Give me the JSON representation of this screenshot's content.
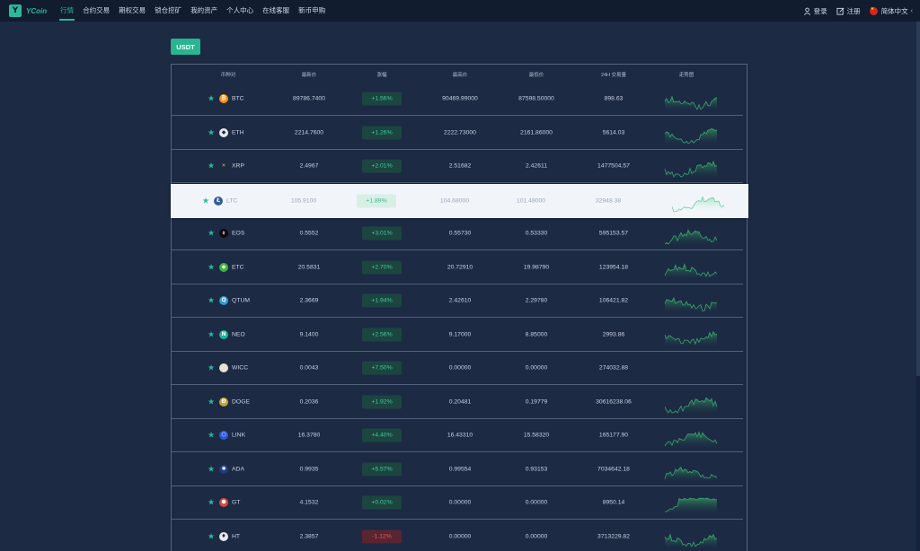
{
  "nav": {
    "logo_glyph": "Y",
    "logo_text": "YCoin",
    "items": [
      {
        "label": "行情",
        "active": true
      },
      {
        "label": "合约交易"
      },
      {
        "label": "期权交易"
      },
      {
        "label": "锁仓挖矿"
      },
      {
        "label": "我的资产"
      },
      {
        "label": "个人中心"
      },
      {
        "label": "在线客服"
      },
      {
        "label": "新币申购"
      }
    ],
    "login": "登录",
    "register": "注册",
    "language": "简体中文",
    "language_caret": "‹"
  },
  "currency_tab": "USDT",
  "table": {
    "headers": [
      "币种对",
      "最新价",
      "涨幅",
      "最高价",
      "最低价",
      "24H 交易量",
      "走势图"
    ],
    "rows": [
      {
        "symbol": "BTC",
        "price": "89786.7400",
        "change": "+1.56%",
        "high": "90469.99000",
        "low": "87598.50000",
        "volume": "898.63",
        "icon": "bitcoin-icon",
        "icon_color": "#f7931a",
        "glyph": "₿",
        "trend": "up"
      },
      {
        "symbol": "ETH",
        "price": "2214.7600",
        "change": "+1.26%",
        "high": "2222.73000",
        "low": "2161.86000",
        "volume": "5614.03",
        "icon": "ethereum-icon",
        "icon_color": "#e6e9ef",
        "glyph": "◆",
        "trend": "up"
      },
      {
        "symbol": "XRP",
        "price": "2.4967",
        "change": "+2.01%",
        "high": "2.51682",
        "low": "2.42611",
        "volume": "1477504.57",
        "icon": "xrp-icon",
        "icon_color": "#1c2a44",
        "glyph": "✕",
        "trend": "up"
      },
      {
        "symbol": "LTC",
        "price": "105.9100",
        "change": "+1.89%",
        "high": "104.68000",
        "low": "101.48000",
        "volume": "32948.38",
        "icon": "litecoin-icon",
        "icon_color": "#345d9d",
        "glyph": "Ł",
        "trend": "up",
        "highlight": true
      },
      {
        "symbol": "EOS",
        "price": "0.5552",
        "change": "+3.01%",
        "high": "0.55730",
        "low": "0.53330",
        "volume": "595153.57",
        "icon": "eos-icon",
        "icon_color": "#0b0b0b",
        "glyph": "⬨",
        "trend": "up"
      },
      {
        "symbol": "ETC",
        "price": "20.5831",
        "change": "+2.70%",
        "high": "20.72910",
        "low": "19.98790",
        "volume": "123954.18",
        "icon": "ethereum-classic-icon",
        "icon_color": "#3ab83a",
        "glyph": "◆",
        "trend": "up"
      },
      {
        "symbol": "QTUM",
        "price": "2.3669",
        "change": "+1.94%",
        "high": "2.42610",
        "low": "2.29780",
        "volume": "106421.82",
        "icon": "qtum-icon",
        "icon_color": "#2e9ad0",
        "glyph": "Q",
        "trend": "up"
      },
      {
        "symbol": "NEO",
        "price": "9.1400",
        "change": "+2.56%",
        "high": "9.17000",
        "low": "8.85000",
        "volume": "2993.86",
        "icon": "neo-icon",
        "icon_color": "#1fb39a",
        "glyph": "N",
        "trend": "up"
      },
      {
        "symbol": "WICC",
        "price": "0.0043",
        "change": "+7.50%",
        "high": "0.00000",
        "low": "0.00000",
        "volume": "274032.88",
        "icon": "wicc-icon",
        "icon_color": "#e8e2d0",
        "glyph": "",
        "trend": "none"
      },
      {
        "symbol": "DOGE",
        "price": "0.2036",
        "change": "+1.92%",
        "high": "0.20481",
        "low": "0.19779",
        "volume": "30616238.06",
        "icon": "dogecoin-icon",
        "icon_color": "#c2a633",
        "glyph": "Ð",
        "trend": "up"
      },
      {
        "symbol": "LINK",
        "price": "16.3780",
        "change": "+4.40%",
        "high": "16.43310",
        "low": "15.58320",
        "volume": "165177.90",
        "icon": "chainlink-icon",
        "icon_color": "#2a5ada",
        "glyph": "⬡",
        "trend": "up"
      },
      {
        "symbol": "ADA",
        "price": "0.9935",
        "change": "+5.57%",
        "high": "0.99554",
        "low": "0.93153",
        "volume": "7034642.18",
        "icon": "cardano-icon",
        "icon_color": "#1f3a8a",
        "glyph": "✺",
        "trend": "up"
      },
      {
        "symbol": "GT",
        "price": "4.1532",
        "change": "+0.02%",
        "high": "0.00000",
        "low": "0.00000",
        "volume": "8950.14",
        "icon": "gatetoken-icon",
        "icon_color": "#d8473b",
        "glyph": "⬢",
        "trend": "flat"
      },
      {
        "symbol": "HT",
        "price": "2.3857",
        "change": "-1.12%",
        "high": "0.00000",
        "low": "0.00000",
        "volume": "3713229.82",
        "icon": "huobi-token-icon",
        "icon_color": "#e6e9ef",
        "glyph": "♦",
        "trend": "up",
        "down": true
      }
    ]
  },
  "colors": {
    "accent": "#2bb99a",
    "up": "#3fcf97",
    "down": "#f05a6a",
    "background": "#1c2a44",
    "nav_background": "#111c2f"
  }
}
